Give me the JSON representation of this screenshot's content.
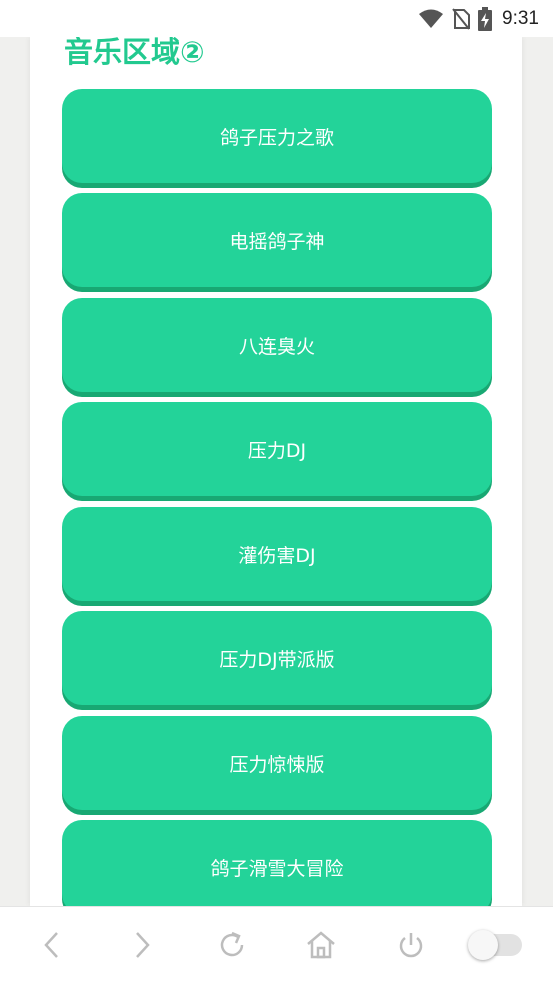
{
  "status_bar": {
    "time": "9:31",
    "icons": [
      "wifi-icon",
      "no-sim-icon",
      "battery-charging-icon"
    ]
  },
  "section": {
    "title": "音乐区域②"
  },
  "buttons": [
    {
      "label": "鸽子压力之歌"
    },
    {
      "label": "电摇鸽子神"
    },
    {
      "label": "八连臭火"
    },
    {
      "label": "压力DJ"
    },
    {
      "label": "灌伤害DJ"
    },
    {
      "label": "压力DJ带派版"
    },
    {
      "label": "压力惊悚版"
    },
    {
      "label": "鸽子滑雪大冒险"
    }
  ],
  "nav_bar": {
    "icons": [
      "back-icon",
      "forward-icon",
      "refresh-icon",
      "home-icon",
      "power-icon",
      "toggle-switch"
    ]
  },
  "colors": {
    "accent": "#23d399",
    "accent_dark": "#18a873",
    "title": "#22c98f"
  }
}
